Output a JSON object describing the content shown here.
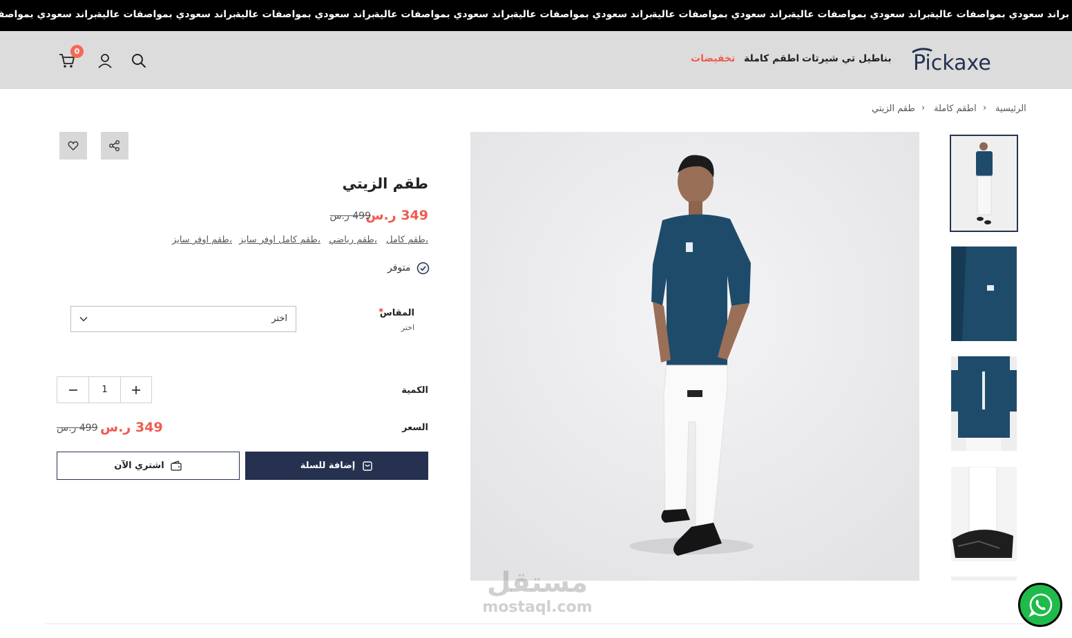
{
  "ticker": {
    "text": "براند سعودي بمواصفات عالية",
    "cut_text": "براند سعودي بمواصفات"
  },
  "header": {
    "logo_text": "Pickaxe",
    "nav": [
      "بناطيل",
      "تي شيرتات",
      "اطقم كاملة",
      "تخفيضات"
    ],
    "cart_count": "0",
    "sale_color": "#f05a4f"
  },
  "breadcrumb": [
    "الرئيسية",
    "اطقم كاملة",
    "طقم الزيتي"
  ],
  "product": {
    "title": "طقم الزيتي",
    "price": "349 ر.س",
    "old_price": "499 ر.س",
    "tags": [
      "طقم كامل،",
      "طقم رياضي،",
      "طقم كامل اوفر سايز،",
      "طقم اوفر سايز،"
    ],
    "stock": "متوفر"
  },
  "options": {
    "size_label": "المقاس",
    "required_mark": "*",
    "size_hint": "اختر",
    "size_placeholder": "اختر",
    "quantity_label": "الكمية",
    "quantity_value": "1",
    "price_label": "السعر",
    "price": "349 ر.س",
    "old_price": "499 ر.س"
  },
  "buttons": {
    "add_to_cart": "إضافة للسلة",
    "buy_now": "اشتري الآن"
  },
  "watermark": {
    "arabic": "مستقل",
    "latin": "mostaql.com"
  },
  "colors": {
    "primary": "#25314f",
    "accent": "#f05a4f",
    "ticker_bg": "#000000",
    "header_bg": "#dcdcdc",
    "shirt": "#1f4b6a"
  },
  "icons": [
    "search-icon",
    "user-icon",
    "cart-icon",
    "share-icon",
    "heart-icon",
    "check-circle-icon",
    "chevron-down-icon",
    "minus-icon",
    "plus-icon",
    "bag-icon",
    "wallet-icon",
    "whatsapp-icon"
  ]
}
